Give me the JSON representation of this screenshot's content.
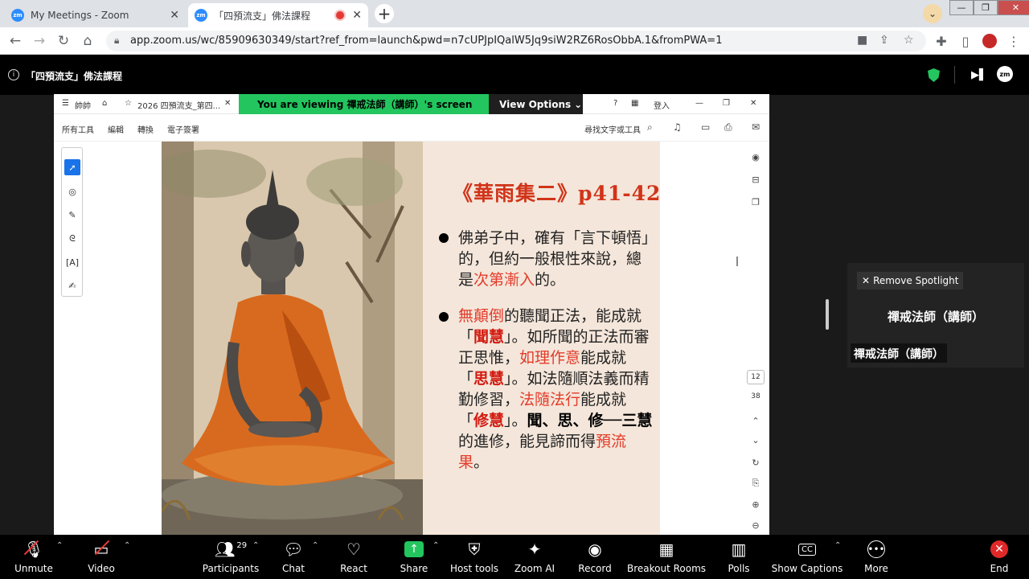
{
  "browser": {
    "tabs": [
      {
        "favicon": "zm",
        "title": "My Meetings - Zoom"
      },
      {
        "favicon": "zm",
        "title": "「四預流支」佛法課程"
      }
    ],
    "new_tab": "+",
    "url": "app.zoom.us/wc/85909630349/start?ref_from=launch&pwd=n7cUPJpIQalW5Jq9siW2RZ6RosObbA.1&fromPWA=1",
    "window_controls": [
      "—",
      "❐",
      "✕"
    ]
  },
  "meeting": {
    "title": "「四預流支」佛法課程",
    "logo": "zm"
  },
  "shared_screen": {
    "menu_label": "帥帥",
    "doc_tab": "2026 四預流支_第四...",
    "viewing_banner": "You are viewing  禪戒法師（講師）'s screen",
    "view_options": "View Options",
    "login": "登入",
    "toolbar_items": [
      "所有工具",
      "編輯",
      "轉換",
      "電子簽署"
    ],
    "search_text": "尋找文字或工具",
    "page_current": "12",
    "page_total": "38",
    "slide": {
      "title": "《華雨集二》p41-42",
      "bullet1": {
        "t1": "佛弟子中，確有「言下頓悟」的，但約一般根性來說，總是",
        "t2": "次第漸入",
        "t3": "的。"
      },
      "bullet2": {
        "a": "無顛倒",
        "b": "的聽聞正法，能成就「",
        "c": "聞慧",
        "d": "」。如所聞的正法而審正思惟，",
        "e": "如理作意",
        "f": "能成就「",
        "g": "思慧",
        "h": "」。如法隨順法義而精勤修習，",
        "i": "法隨法行",
        "j": "能成就「",
        "k": "修慧",
        "l": "」。",
        "m": "聞、思、修──三慧",
        "n": "的進修，能見諦而得",
        "o": "預流果",
        "p": "。"
      }
    }
  },
  "spotlight": {
    "remove_label": "Remove Spotlight",
    "name": "禪戒法師（講師）",
    "name_tag": "禪戒法師（講師）"
  },
  "toolbar": {
    "unmute": "Unmute",
    "video": "Video",
    "participants": "Participants",
    "participants_count": "29",
    "chat": "Chat",
    "react": "React",
    "share": "Share",
    "host_tools": "Host tools",
    "zoom_ai": "Zoom AI",
    "record": "Record",
    "breakout": "Breakout Rooms",
    "polls": "Polls",
    "captions": "Show Captions",
    "more": "More",
    "end": "End"
  }
}
